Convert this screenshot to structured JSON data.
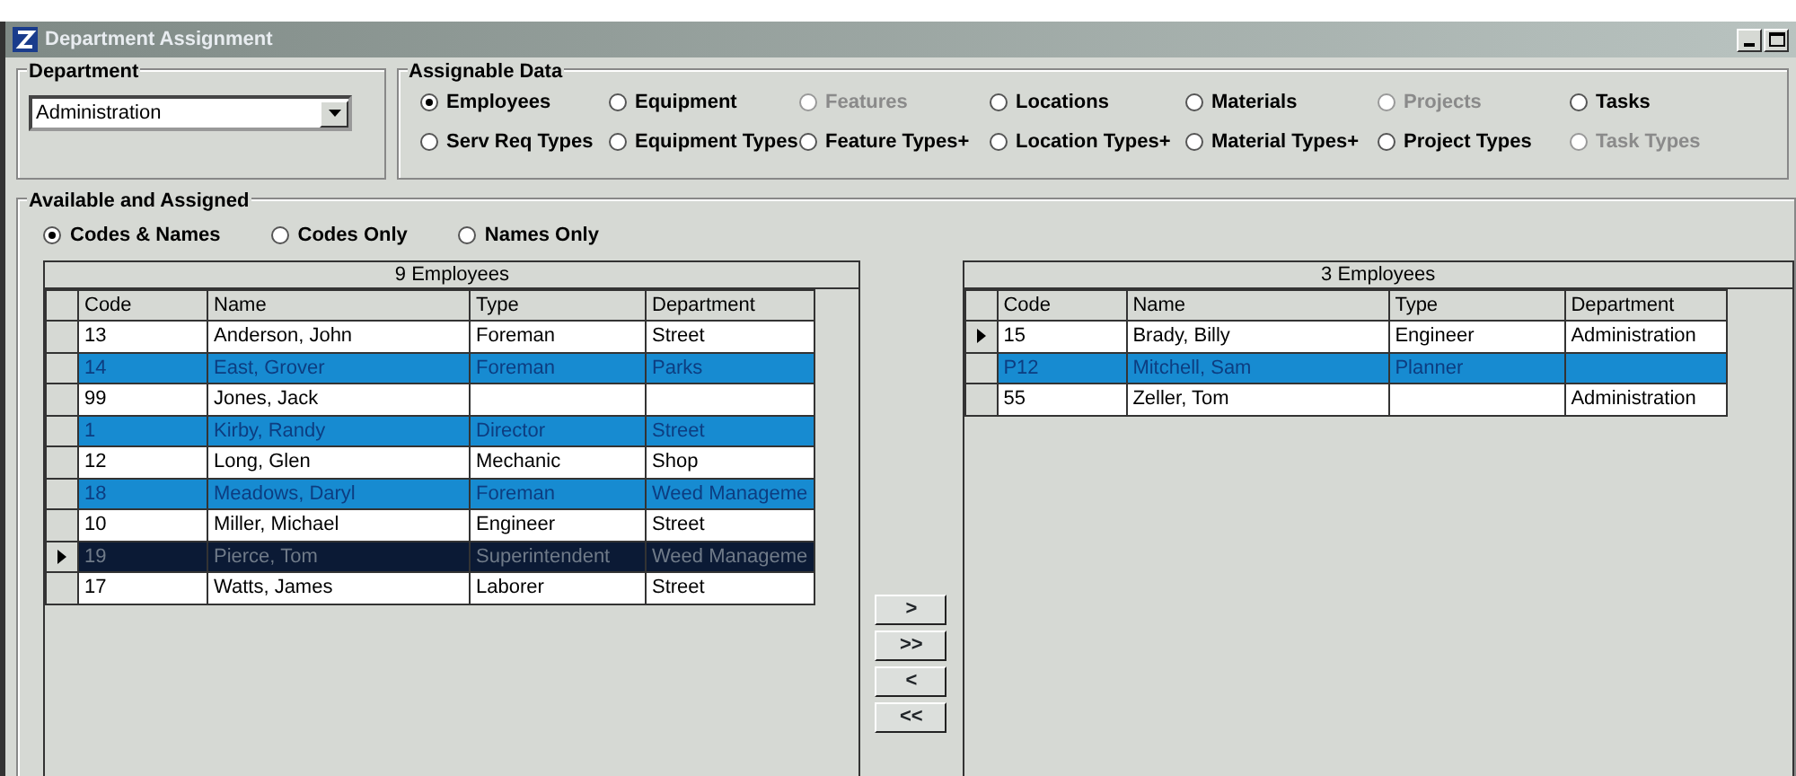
{
  "window": {
    "title": "Department Assignment"
  },
  "department": {
    "label": "Department",
    "value": "Administration"
  },
  "assignable_data": {
    "label": "Assignable Data",
    "options": [
      {
        "label": "Employees",
        "selected": true,
        "disabled": false
      },
      {
        "label": "Equipment",
        "selected": false,
        "disabled": false
      },
      {
        "label": "Features",
        "selected": false,
        "disabled": true
      },
      {
        "label": "Locations",
        "selected": false,
        "disabled": false
      },
      {
        "label": "Materials",
        "selected": false,
        "disabled": false
      },
      {
        "label": "Projects",
        "selected": false,
        "disabled": true
      },
      {
        "label": "Tasks",
        "selected": false,
        "disabled": false
      },
      {
        "label": "Serv Req Types",
        "selected": false,
        "disabled": false
      },
      {
        "label": "Equipment Types",
        "selected": false,
        "disabled": false
      },
      {
        "label": "Feature Types+",
        "selected": false,
        "disabled": false
      },
      {
        "label": "Location Types+",
        "selected": false,
        "disabled": false
      },
      {
        "label": "Material Types+",
        "selected": false,
        "disabled": false
      },
      {
        "label": "Project Types",
        "selected": false,
        "disabled": false
      },
      {
        "label": "Task Types",
        "selected": false,
        "disabled": true
      }
    ]
  },
  "available_assigned": {
    "label": "Available and Assigned",
    "view_options": [
      {
        "label": "Codes & Names",
        "selected": true
      },
      {
        "label": "Codes Only",
        "selected": false
      },
      {
        "label": "Names Only",
        "selected": false
      }
    ]
  },
  "available": {
    "caption": "9 Employees",
    "columns": [
      "Code",
      "Name",
      "Type",
      "Department"
    ],
    "rows": [
      {
        "cells": [
          "13",
          "Anderson, John",
          "Foreman",
          "Street"
        ],
        "selected": false,
        "current": false
      },
      {
        "cells": [
          "14",
          "East, Grover",
          "Foreman",
          "Parks"
        ],
        "selected": true,
        "current": false
      },
      {
        "cells": [
          "99",
          "Jones, Jack",
          "",
          ""
        ],
        "selected": false,
        "current": false
      },
      {
        "cells": [
          "1",
          "Kirby, Randy",
          "Director",
          "Street"
        ],
        "selected": true,
        "current": false
      },
      {
        "cells": [
          "12",
          "Long, Glen",
          "Mechanic",
          "Shop"
        ],
        "selected": false,
        "current": false
      },
      {
        "cells": [
          "18",
          "Meadows, Daryl",
          "Foreman",
          "Weed Manageme"
        ],
        "selected": true,
        "current": false
      },
      {
        "cells": [
          "10",
          "Miller, Michael",
          "Engineer",
          "Street"
        ],
        "selected": false,
        "current": false
      },
      {
        "cells": [
          "19",
          "Pierce, Tom",
          "Superintendent",
          "Weed Manageme"
        ],
        "selected": true,
        "current": true
      },
      {
        "cells": [
          "17",
          "Watts, James",
          "Laborer",
          "Street"
        ],
        "selected": false,
        "current": false
      }
    ]
  },
  "move_buttons": [
    ">",
    ">>",
    "<",
    "<<"
  ],
  "assigned": {
    "caption": "3 Employees",
    "columns": [
      "Code",
      "Name",
      "Type",
      "Department"
    ],
    "rows": [
      {
        "cells": [
          "15",
          "Brady, Billy",
          "Engineer",
          "Administration"
        ],
        "selected": false,
        "current": true
      },
      {
        "cells": [
          "P12",
          "Mitchell, Sam",
          "Planner",
          ""
        ],
        "selected": true,
        "current": false
      },
      {
        "cells": [
          "55",
          "Zeller, Tom",
          "",
          "Administration"
        ],
        "selected": false,
        "current": false
      }
    ]
  }
}
